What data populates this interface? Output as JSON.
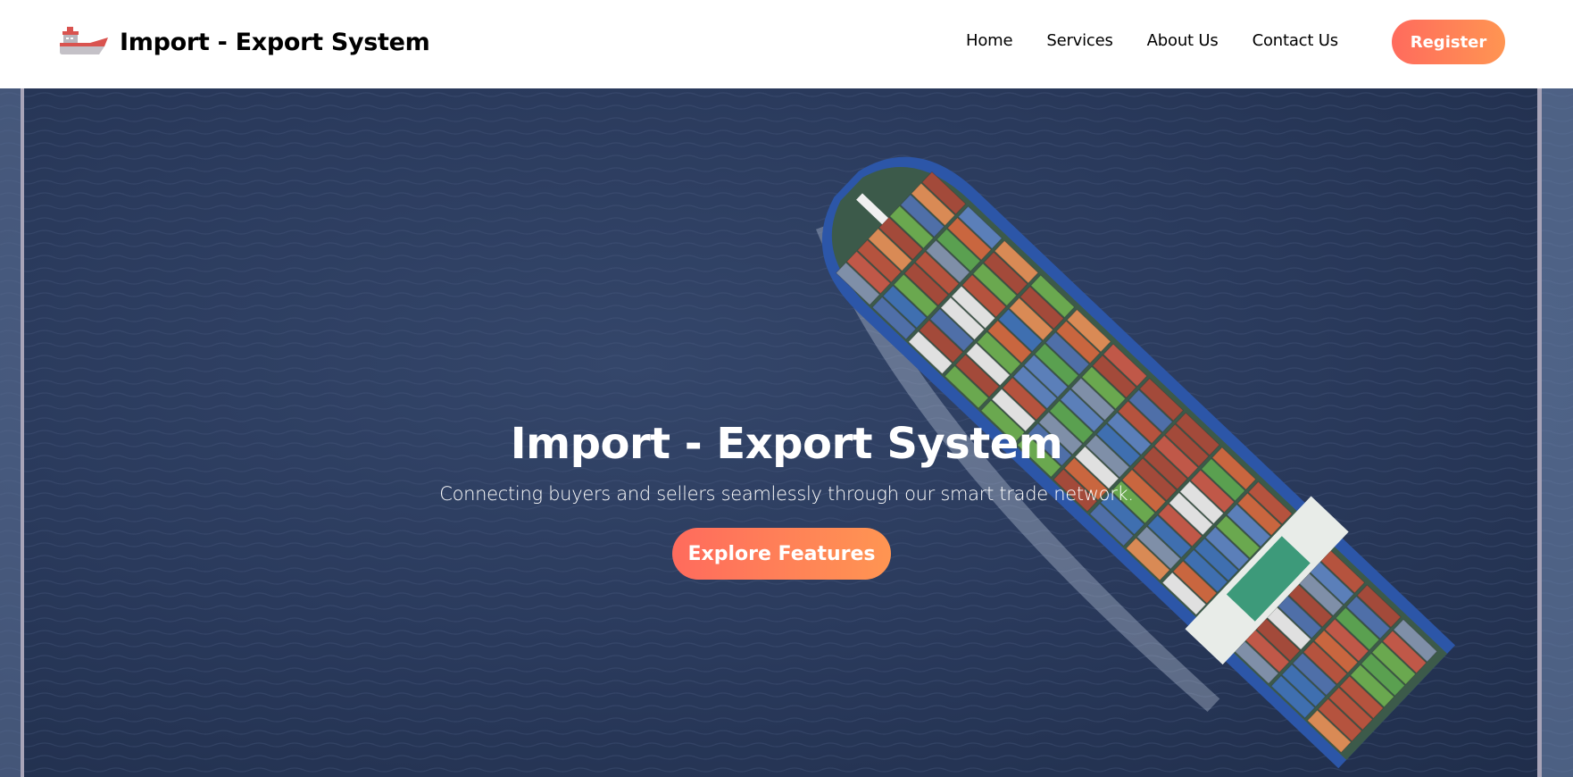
{
  "header": {
    "logo_icon": "ship-icon",
    "title": "Import - Export System",
    "nav": [
      {
        "label": "Home"
      },
      {
        "label": "Services"
      },
      {
        "label": "About Us"
      },
      {
        "label": "Contact Us"
      }
    ],
    "register_label": "Register"
  },
  "hero": {
    "background": "container-ship-aerial-photo",
    "title": "Import - Export System",
    "subtitle": "Connecting buyers and sellers seamlessly through our smart trade network.",
    "cta_label": "Explore Features"
  },
  "colors": {
    "accent_start": "#ff6b5d",
    "accent_end": "#ff9552",
    "ocean": "#2a3a5c"
  }
}
